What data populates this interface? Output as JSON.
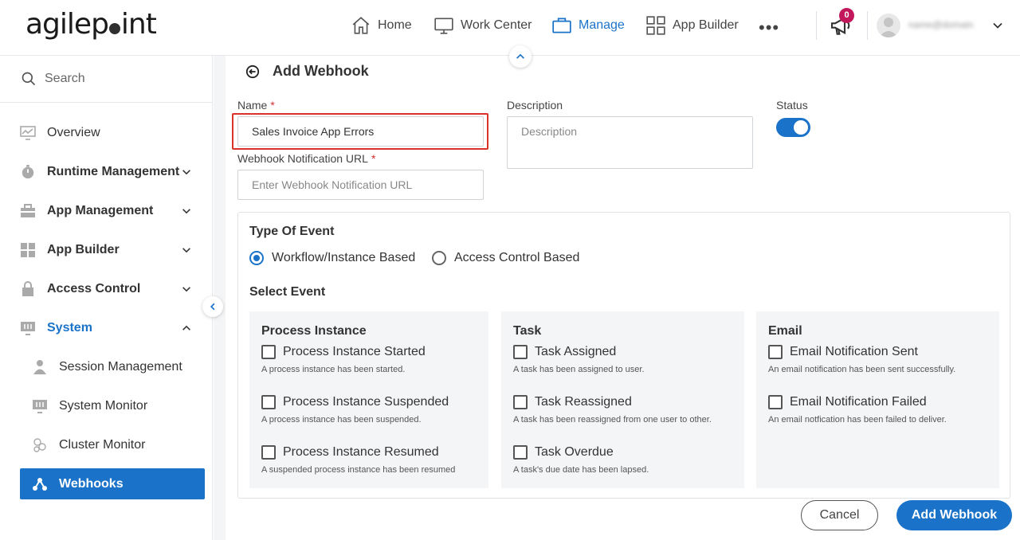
{
  "app": {
    "logo": "agilepoint"
  },
  "nav": {
    "home": "Home",
    "work_center": "Work Center",
    "manage": "Manage",
    "app_builder": "App Builder",
    "more": "•••",
    "notification_count": "0",
    "user_name": "name@domain"
  },
  "sidebar": {
    "search_label": "Search",
    "items": [
      {
        "label": "Overview"
      },
      {
        "label": "Runtime Management"
      },
      {
        "label": "App Management"
      },
      {
        "label": "App Builder"
      },
      {
        "label": "Access Control"
      },
      {
        "label": "System"
      },
      {
        "label": "Session Management"
      },
      {
        "label": "System Monitor"
      },
      {
        "label": "Cluster Monitor"
      },
      {
        "label": "Webhooks"
      }
    ]
  },
  "page": {
    "title": "Add Webhook"
  },
  "form": {
    "name_label": "Name",
    "required_mark": "*",
    "name_value": "Sales Invoice App Errors",
    "url_label": "Webhook Notification URL",
    "url_placeholder": "Enter Webhook Notification URL",
    "description_label": "Description",
    "description_placeholder": "Description",
    "status_label": "Status",
    "status_on": true
  },
  "events": {
    "type_title": "Type Of Event",
    "type_options": [
      "Workflow/Instance Based",
      "Access Control Based"
    ],
    "selected_type": "Workflow/Instance Based",
    "select_title": "Select Event",
    "columns": [
      {
        "title": "Process Instance",
        "items": [
          {
            "label": "Process Instance Started",
            "desc": "A process instance has been started."
          },
          {
            "label": "Process Instance Suspended",
            "desc": "A process instance has been suspended."
          },
          {
            "label": "Process Instance Resumed",
            "desc": "A suspended process instance has been resumed"
          }
        ]
      },
      {
        "title": "Task",
        "items": [
          {
            "label": "Task Assigned",
            "desc": "A task has been assigned to user."
          },
          {
            "label": "Task Reassigned",
            "desc": "A task has been reassigned from one user to other."
          },
          {
            "label": "Task Overdue",
            "desc": "A task's due date has been lapsed."
          }
        ]
      },
      {
        "title": "Email",
        "items": [
          {
            "label": "Email Notification Sent",
            "desc": "An email notification has been sent successfully."
          },
          {
            "label": "Email Notification Failed",
            "desc": "An email notfication has been failed to deliver."
          }
        ]
      }
    ]
  },
  "actions": {
    "cancel": "Cancel",
    "submit": "Add Webhook"
  },
  "colors": {
    "accent": "#1a73c9",
    "highlight": "#d9322b",
    "badge": "#c2185b"
  }
}
